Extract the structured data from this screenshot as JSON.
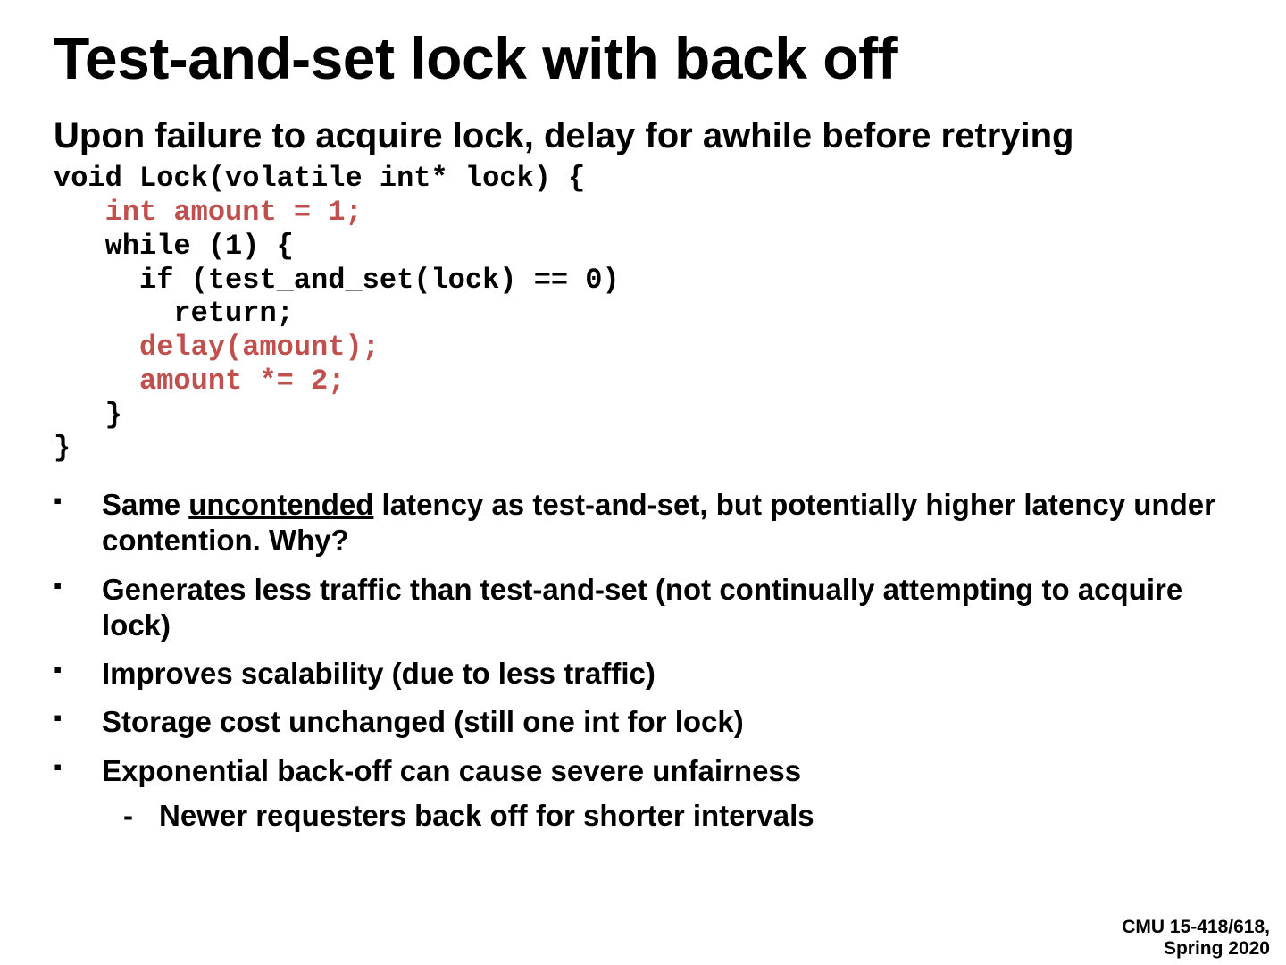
{
  "title": "Test-and-set lock with back off",
  "subtitle": "Upon failure to acquire lock, delay for awhile before retrying",
  "code": {
    "l1": "void Lock(volatile int* lock) {",
    "l2": "   int amount = 1;",
    "l3": "   while (1) {",
    "l4": "     if (test_and_set(lock) == 0)",
    "l5": "       return;",
    "l6": "     delay(amount);",
    "l7": "     amount *= 2;",
    "l8": "   }",
    "l9": "}"
  },
  "bullets": {
    "b1_pre": "Same ",
    "b1_u": "uncontended",
    "b1_post": " latency as test-and-set, but potentially higher latency under contention. Why?",
    "b2": "Generates less traffic than test-and-set (not continually attempting to acquire lock)",
    "b3": "Improves scalability (due to less traffic)",
    "b4": "Storage cost unchanged (still one int for lock)",
    "b5": "Exponential back-off can cause severe unfairness",
    "b5_sub": "Newer requesters back off for shorter intervals"
  },
  "footer": {
    "course": "CMU 15-418/618,",
    "term": "Spring 2020"
  }
}
